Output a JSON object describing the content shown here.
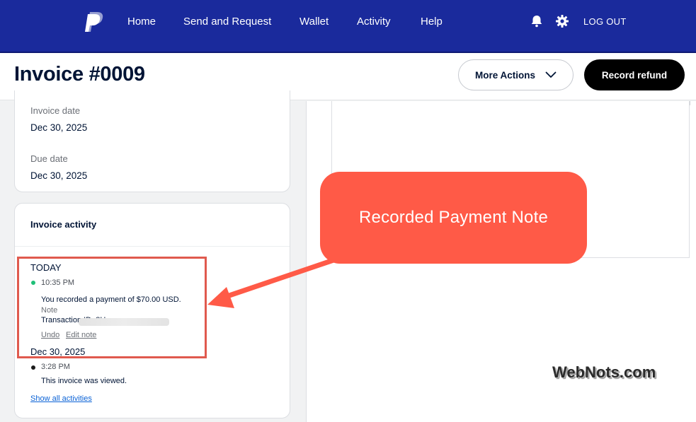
{
  "nav": {
    "items": [
      "Home",
      "Send and Request",
      "Wallet",
      "Activity",
      "Help"
    ],
    "logout": "LOG OUT",
    "icons": [
      "paypal-logo-icon",
      "bell-icon",
      "gear-icon"
    ],
    "colors": {
      "bar": "#1a2a9c",
      "accent": "#ff5a47"
    }
  },
  "header": {
    "title": "Invoice #0009",
    "more_actions": "More Actions",
    "record_refund": "Record refund"
  },
  "dates": {
    "invoice_date_label": "Invoice date",
    "invoice_date": "Dec 30, 2025",
    "due_date_label": "Due date",
    "due_date": "Dec 30, 2025"
  },
  "activity": {
    "title": "Invoice activity",
    "group1": "TODAY",
    "entry1_time": "10:35 PM",
    "entry1_text": "You recorded a payment of $70.00 USD.",
    "entry1_note": "Note",
    "entry1_txn": "Transaction ID: 8H",
    "undo": "Undo",
    "edit_note": "Edit note",
    "group2": "Dec 30, 2025",
    "entry2_time": "3:28 PM",
    "entry2_text": "This invoice was viewed.",
    "show_all": "Show all activities"
  },
  "callout": {
    "text": "Recorded Payment Note"
  },
  "watermark": "WebNots.com"
}
